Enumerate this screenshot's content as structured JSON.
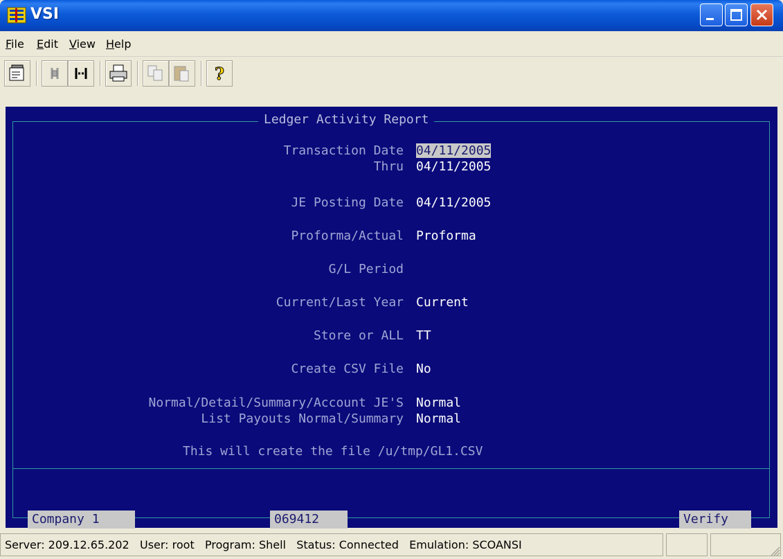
{
  "window": {
    "title": "VSI"
  },
  "menu": {
    "items": [
      {
        "label": "File",
        "key": "F",
        "rest": "ile"
      },
      {
        "label": "Edit",
        "key": "E",
        "rest": "dit"
      },
      {
        "label": "View",
        "key": "V",
        "rest": "iew"
      },
      {
        "label": "Help",
        "key": "H",
        "rest": "elp"
      }
    ]
  },
  "toolbar": {
    "icons": [
      "properties-icon",
      "connect-icon",
      "disconnect-icon",
      "print-icon",
      "copy-icon",
      "paste-icon",
      "help-icon"
    ]
  },
  "terminal": {
    "title": "Ledger Activity Report",
    "fields": {
      "transaction_date_label": "Transaction Date",
      "transaction_date_value": "04/11/2005",
      "thru_label": "Thru",
      "thru_value": "04/11/2005",
      "je_posting_date_label": "JE Posting Date",
      "je_posting_date_value": "04/11/2005",
      "proforma_actual_label": "Proforma/Actual",
      "proforma_actual_value": "Proforma",
      "gl_period_label": "G/L Period",
      "gl_period_value": "",
      "current_last_year_label": "Current/Last Year",
      "current_last_year_value": "Current",
      "store_or_all_label": "Store or ALL",
      "store_or_all_value": "TT",
      "create_csv_label": "Create CSV File",
      "create_csv_value": "No",
      "normal_detail_label": "Normal/Detail/Summary/Account JE'S",
      "normal_detail_value": "Normal",
      "list_payouts_label": "List Payouts Normal/Summary",
      "list_payouts_value": "Normal"
    },
    "note": "This will create the file /u/tmp/GL1.CSV",
    "footer": {
      "company": "Company 1",
      "code": "069412",
      "action": "Verify"
    }
  },
  "status": {
    "text": "Server: 209.12.65.202   User: root   Program: Shell   Status: Connected   Emulation: SCOANSI"
  },
  "colors": {
    "terminal_bg": "#0a0a7a",
    "frame": "#2f9aa0",
    "highlight": "#c8c8c8",
    "titlebar": "#0a5bdc"
  }
}
